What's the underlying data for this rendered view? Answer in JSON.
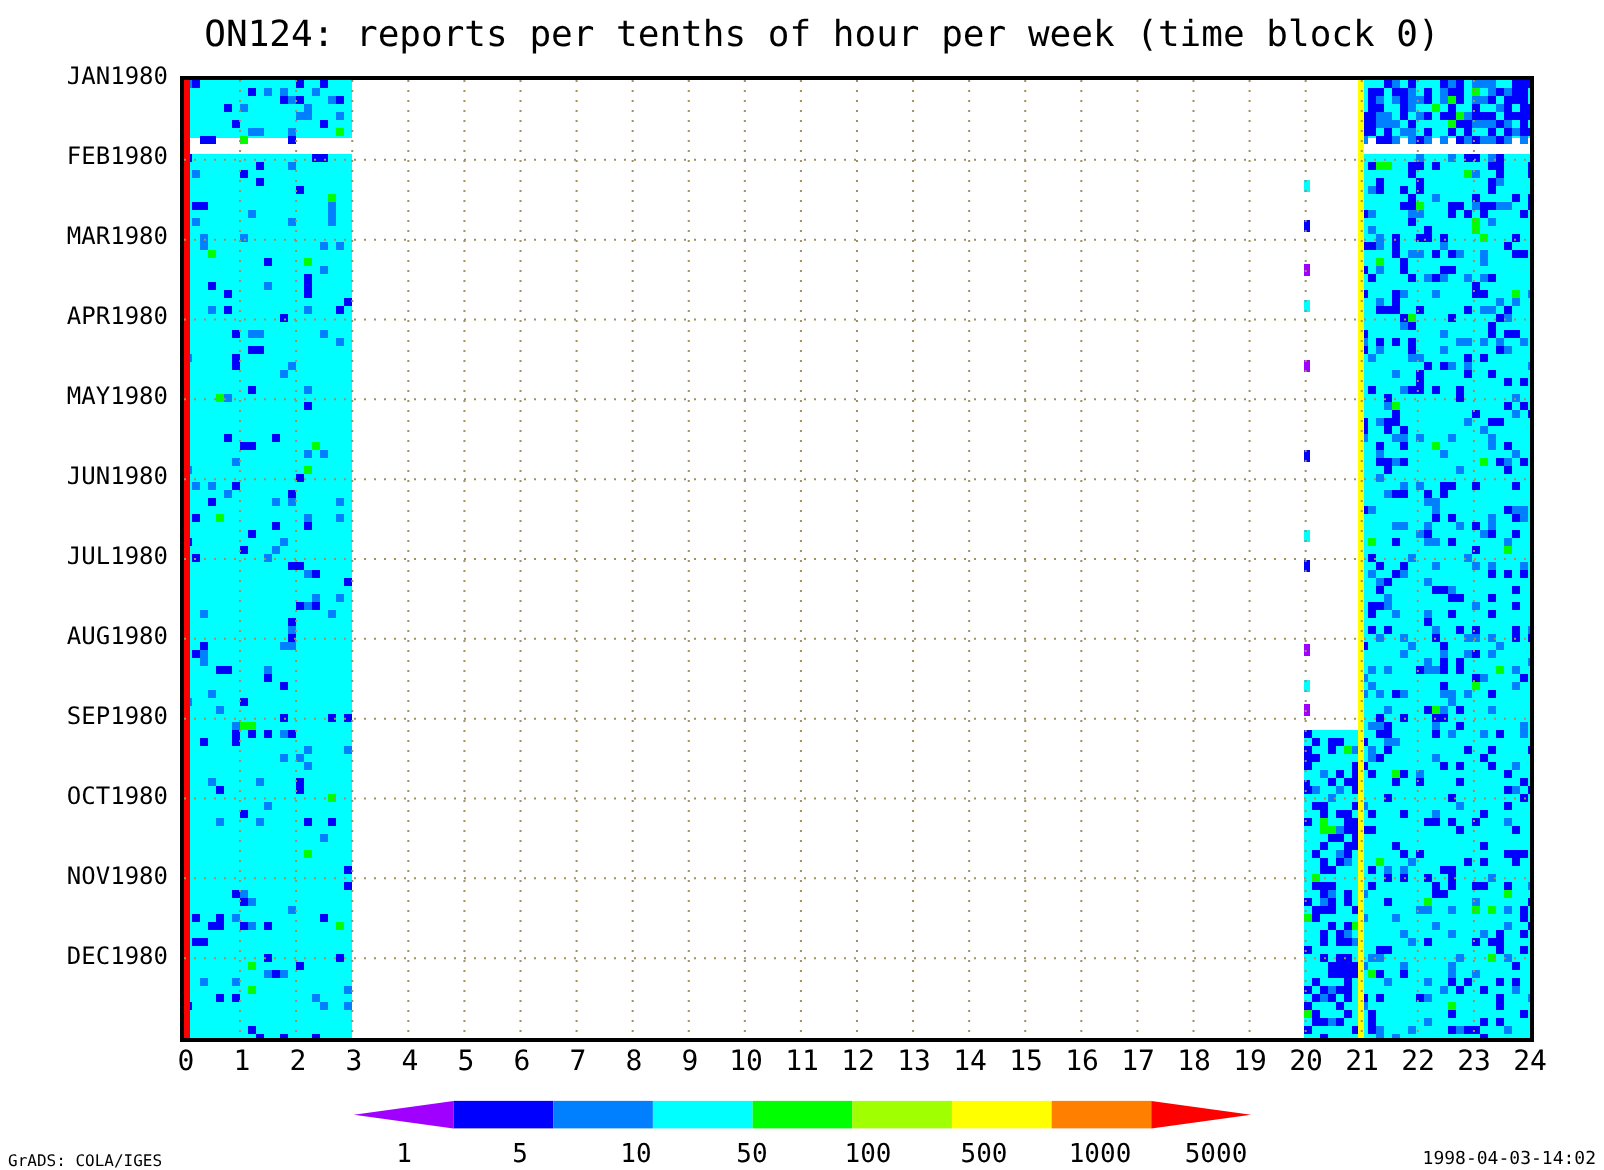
{
  "title": "ON124: reports per tenths of hour per week (time block 0)",
  "y_labels": [
    "JAN1980",
    "FEB1980",
    "MAR1980",
    "APR1980",
    "MAY1980",
    "JUN1980",
    "JUL1980",
    "AUG1980",
    "SEP1980",
    "OCT1980",
    "NOV1980",
    "DEC1980"
  ],
  "x_labels": [
    "0",
    "1",
    "2",
    "3",
    "4",
    "5",
    "6",
    "7",
    "8",
    "9",
    "10",
    "11",
    "12",
    "13",
    "14",
    "15",
    "16",
    "17",
    "18",
    "19",
    "20",
    "21",
    "22",
    "23",
    "24"
  ],
  "colorbar": {
    "segments": [
      {
        "color": "#a000ff"
      },
      {
        "color": "#0000ff"
      },
      {
        "color": "#0080ff"
      },
      {
        "color": "#00ffff"
      },
      {
        "color": "#00ff00"
      },
      {
        "color": "#a0ff00"
      },
      {
        "color": "#ffff00"
      },
      {
        "color": "#ff8000"
      },
      {
        "color": "#ff0000"
      }
    ],
    "labels": [
      "1",
      "5",
      "10",
      "50",
      "100",
      "500",
      "1000",
      "5000"
    ]
  },
  "footer": {
    "left": "GrADS: COLA/IGES",
    "right": "1998-04-03-14:02"
  }
}
